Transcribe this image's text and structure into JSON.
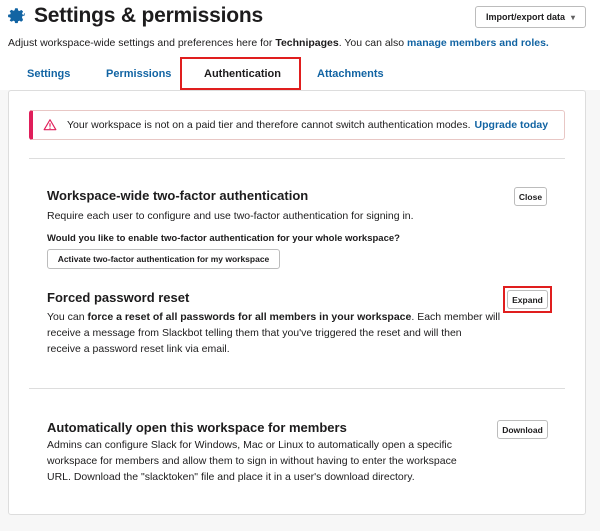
{
  "header": {
    "title": "Settings & permissions",
    "import_label": "Import/export data",
    "import_dropdown": "▾",
    "subtitle_prefix": "Adjust workspace-wide settings and preferences here for ",
    "workspace_name": "Technipages",
    "subtitle_mid": ". You can also ",
    "subtitle_link": "manage members and roles."
  },
  "tabs": [
    {
      "label": "Settings"
    },
    {
      "label": "Permissions"
    },
    {
      "label": "Authentication"
    },
    {
      "label": "Attachments"
    }
  ],
  "alert": {
    "text": "Your workspace is not on a paid tier and therefore cannot switch authentication modes.",
    "link": "Upgrade today"
  },
  "two_factor": {
    "title": "Workspace-wide two-factor authentication",
    "desc": "Require each user to configure and use two-factor authentication for signing in.",
    "question": "Would you like to enable two-factor authentication for your whole workspace?",
    "activate_label": "Activate two-factor authentication for my workspace",
    "close_label": "Close"
  },
  "password_reset": {
    "title": "Forced password reset",
    "desc_prefix": "You can ",
    "desc_bold": "force a reset of all passwords for all members in your workspace",
    "desc_line1_suffix": ". Each member will",
    "desc_line2": "receive a message from Slackbot telling them that you've triggered the reset and will then",
    "desc_line3": "receive a password reset link via email.",
    "expand_label": "Expand"
  },
  "auto_open": {
    "title": "Automatically open this workspace for members",
    "desc_line1": "Admins can configure Slack for Windows, Mac or Linux to automatically open a specific",
    "desc_line2": "workspace for members and allow them to sign in without having to enter the workspace",
    "desc_line3": "URL. Download the \"slacktoken\" file and place it in a user's download directory.",
    "download_label": "Download"
  },
  "colors": {
    "link": "#1264a3",
    "alert_accent": "#e01e5a",
    "highlight_box": "#e01e1e"
  }
}
